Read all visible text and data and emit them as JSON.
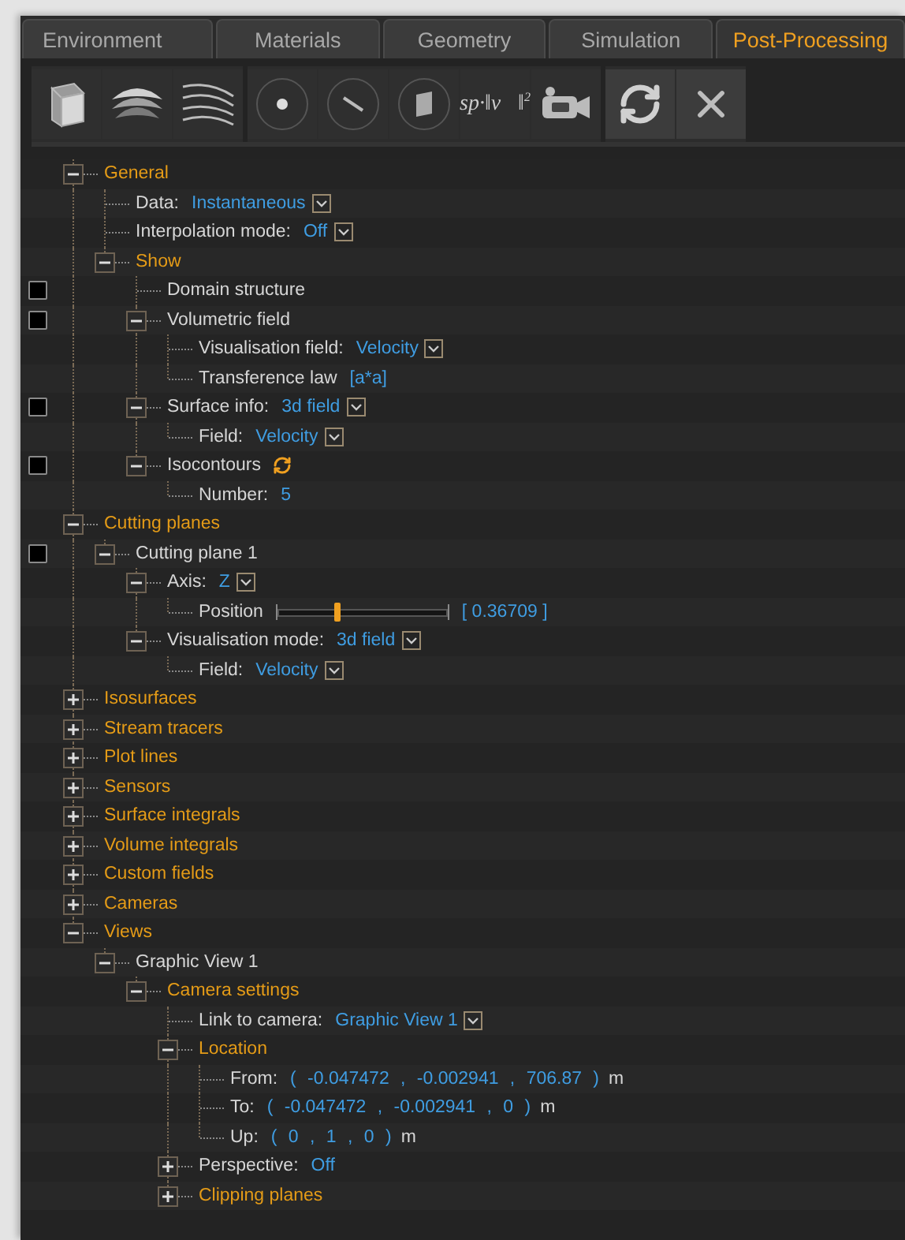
{
  "tabs": [
    {
      "label": "Environment",
      "selected": false
    },
    {
      "label": "Materials",
      "selected": false
    },
    {
      "label": "Geometry",
      "selected": false
    },
    {
      "label": "Simulation",
      "selected": false
    },
    {
      "label": "Post-Processing",
      "selected": true
    }
  ],
  "toolbar": [
    [
      {
        "kind": "cube"
      },
      {
        "kind": "surface"
      },
      {
        "kind": "streamlines"
      }
    ],
    [
      {
        "kind": "point"
      },
      {
        "kind": "line"
      },
      {
        "kind": "plane"
      },
      {
        "kind": "formula",
        "label": "sp·‖v⃗‖$^{2}$"
      },
      {
        "kind": "camera"
      }
    ],
    [
      {
        "kind": "refresh"
      },
      {
        "kind": "close"
      }
    ]
  ],
  "tree": [
    {
      "kind": "section",
      "label": "General",
      "expanded": true,
      "children": [
        {
          "kind": "item",
          "label": "Data:",
          "value": "Instantaneous",
          "dropdown": true
        },
        {
          "kind": "item",
          "label": "Interpolation mode:",
          "value": "Off",
          "dropdown": true
        },
        {
          "kind": "section",
          "label": "Show",
          "expanded": true,
          "children": [
            {
              "kind": "item",
              "label": "Domain structure",
              "checkbox": {
                "checked": false
              }
            },
            {
              "kind": "item",
              "label": "Volumetric field",
              "checkbox": {
                "checked": false
              },
              "expanded": true,
              "children": [
                {
                  "kind": "item",
                  "label": "Visualisation field:",
                  "value": "Velocity",
                  "dropdown": true
                },
                {
                  "kind": "item",
                  "label": "Transference law",
                  "value": "[a*a]"
                }
              ]
            },
            {
              "kind": "item",
              "label": "Surface info:",
              "value": "3d field",
              "dropdown": true,
              "checkbox": {
                "checked": false
              },
              "expanded": true,
              "children": [
                {
                  "kind": "item",
                  "label": "Field:",
                  "value": "Velocity",
                  "dropdown": true
                }
              ]
            },
            {
              "kind": "item",
              "label": "Isocontours",
              "refresh": true,
              "checkbox": {
                "checked": false
              },
              "expanded": true,
              "children": [
                {
                  "kind": "item",
                  "label": "Number:",
                  "value": "5"
                }
              ]
            }
          ]
        }
      ]
    },
    {
      "kind": "section",
      "label": "Cutting planes",
      "expanded": true,
      "children": [
        {
          "kind": "item",
          "label": "Cutting plane 1",
          "checkbox": {
            "checked": false
          },
          "expanded": true,
          "children": [
            {
              "kind": "item",
              "label": "Axis:",
              "value": "Z",
              "dropdown": true,
              "expanded": true,
              "children": [
                {
                  "kind": "slider",
                  "label": "Position",
                  "level": 0.35,
                  "value": "[  0.36709  ]"
                }
              ]
            },
            {
              "kind": "item",
              "label": "Visualisation mode:",
              "value": "3d field",
              "dropdown": true,
              "expanded": true,
              "children": [
                {
                  "kind": "item",
                  "label": "Field:",
                  "value": "Velocity",
                  "dropdown": true
                }
              ]
            }
          ]
        }
      ]
    },
    {
      "kind": "section",
      "label": "Isosurfaces",
      "expanded": false
    },
    {
      "kind": "section",
      "label": "Stream tracers",
      "expanded": false
    },
    {
      "kind": "section",
      "label": "Plot lines",
      "expanded": false
    },
    {
      "kind": "section",
      "label": "Sensors",
      "expanded": false
    },
    {
      "kind": "section",
      "label": "Surface integrals",
      "expanded": false
    },
    {
      "kind": "section",
      "label": "Volume integrals",
      "expanded": false
    },
    {
      "kind": "section",
      "label": "Custom fields",
      "expanded": false
    },
    {
      "kind": "section",
      "label": "Cameras",
      "expanded": false
    },
    {
      "kind": "section",
      "label": "Views",
      "expanded": true,
      "children": [
        {
          "kind": "item",
          "label": "Graphic View 1",
          "expanded": true,
          "children": [
            {
              "kind": "section",
              "label": "Camera settings",
              "expanded": true,
              "children": [
                {
                  "kind": "item",
                  "label": "Link to camera:",
                  "value": "Graphic View 1",
                  "dropdown": true
                },
                {
                  "kind": "section",
                  "label": "Location",
                  "expanded": true,
                  "children": [
                    {
                      "kind": "vector",
                      "label": "From:",
                      "value": "( -0.047472 , -0.002941 , 706.87 )",
                      "unit": "m"
                    },
                    {
                      "kind": "vector",
                      "label": "To:",
                      "value": "( -0.047472 , -0.002941 , 0 )",
                      "unit": "m"
                    },
                    {
                      "kind": "vector",
                      "label": "Up:",
                      "value": "( 0 , 1 , 0 )",
                      "unit": "m"
                    }
                  ]
                },
                {
                  "kind": "item",
                  "label": "Perspective:",
                  "value": "Off",
                  "expanded": false
                },
                {
                  "kind": "section",
                  "label": "Clipping planes",
                  "expanded": false
                }
              ]
            }
          ]
        }
      ]
    }
  ]
}
